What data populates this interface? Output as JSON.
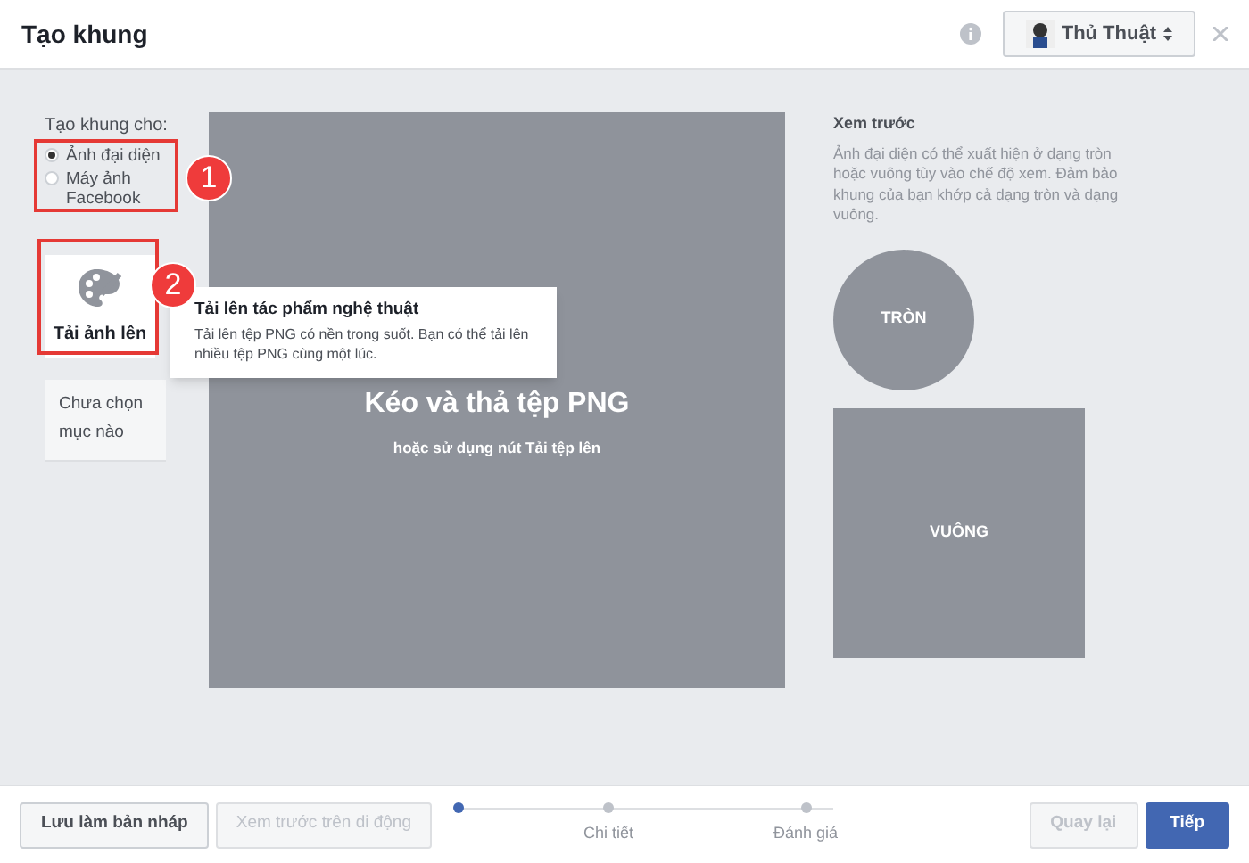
{
  "window": {
    "title": "Tạo khung",
    "account": "Thủ Thuật"
  },
  "frame_for": {
    "label": "Tạo khung cho:",
    "options": [
      {
        "label": "Ảnh đại diện",
        "selected": true
      },
      {
        "label": "Máy ảnh Facebook",
        "selected": false
      }
    ]
  },
  "upload": {
    "label": "Tải ảnh lên"
  },
  "selection": {
    "text": "Chưa chọn mục nào"
  },
  "tooltip": {
    "title": "Tải lên tác phẩm nghệ thuật",
    "text": "Tải lên tệp PNG có nền trong suốt. Bạn có thể tải lên nhiều tệp PNG cùng một lúc."
  },
  "canvas": {
    "title": "Kéo và thả tệp PNG",
    "subtitle": "hoặc sử dụng nút Tải tệp lên"
  },
  "preview": {
    "title": "Xem trước",
    "text": "Ảnh đại diện có thể xuất hiện ở dạng tròn hoặc vuông tùy vào chế độ xem. Đảm bảo khung của bạn khớp cả dạng tròn và dạng vuông.",
    "circle": "TRÒN",
    "square": "VUÔNG"
  },
  "annotations": [
    "1",
    "2"
  ],
  "footer": {
    "save": "Lưu làm bản nháp",
    "preview": "Xem trước trên di động",
    "steps": [
      {
        "selected": true
      },
      {
        "label": "Chi tiết",
        "selected": false
      },
      {
        "label": "Đánh giá",
        "selected": false
      }
    ],
    "back": {
      "label": "Quay lại",
      "disabled": true
    },
    "next": "Tiếp"
  }
}
